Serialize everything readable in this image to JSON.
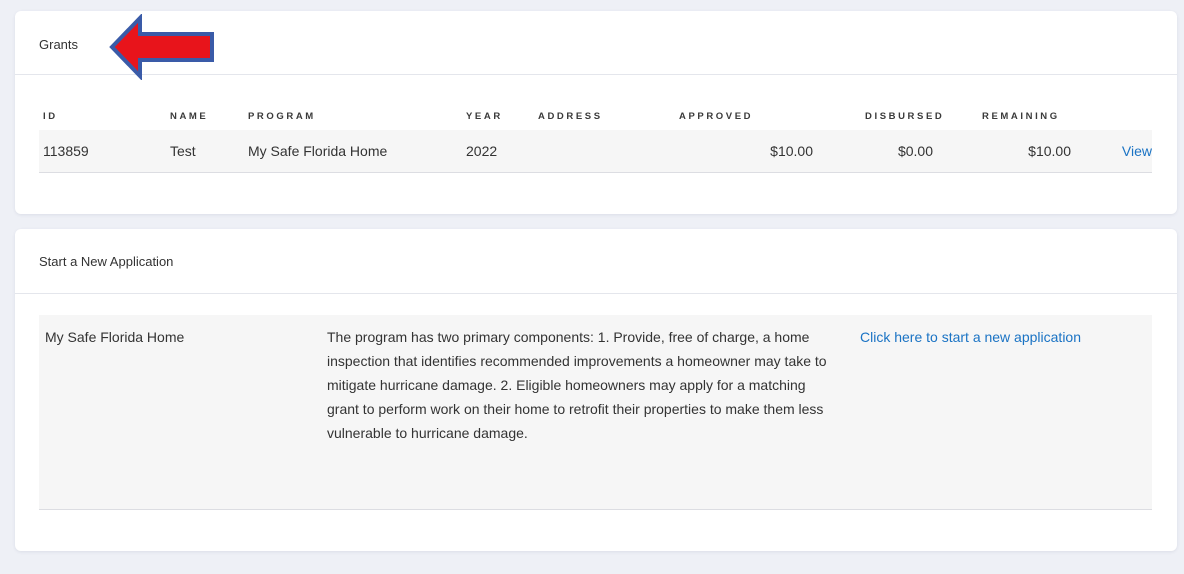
{
  "grants": {
    "title": "Grants",
    "columns": {
      "id": "ID",
      "name": "NAME",
      "program": "PROGRAM",
      "year": "YEAR",
      "address": "ADDRESS",
      "approved": "APPROVED",
      "disbursed": "DISBURSED",
      "remaining": "REMAINING"
    },
    "rows": [
      {
        "id": "113859",
        "name": "Test",
        "program": "My Safe Florida Home",
        "year": "2022",
        "address": "",
        "approved": "$10.00",
        "disbursed": "$0.00",
        "remaining": "$10.00",
        "action": "View"
      }
    ]
  },
  "new_application": {
    "title": "Start a New Application",
    "program_name": "My Safe Florida Home",
    "description": "The program has two primary components: 1. Provide, free of charge, a home inspection that identifies recommended improvements a homeowner may take to mitigate hurricane damage. 2. Eligible homeowners may apply for a matching grant to perform work on their home to retrofit their properties to make them less vulnerable to hurricane damage.",
    "link_label": "Click here to start a new application"
  },
  "annotation": {
    "arrow_icon": "left-arrow-icon",
    "fill_color": "#e8141b",
    "stroke_color": "#3a5ba8"
  },
  "colors": {
    "background": "#eef0f6",
    "link": "#1a73c4",
    "row_background": "#f6f6f6"
  }
}
